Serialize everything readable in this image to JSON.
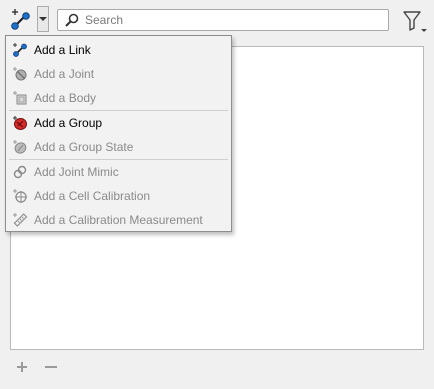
{
  "toolbar": {
    "add_button_icon": "link-add-icon",
    "dropdown_icon": "chevron-down-icon",
    "filter_icon": "filter-icon"
  },
  "search": {
    "placeholder": "Search",
    "value": ""
  },
  "menu": {
    "items": [
      {
        "label": "Add a Link",
        "icon": "link-icon",
        "enabled": true
      },
      {
        "label": "Add a Joint",
        "icon": "joint-icon",
        "enabled": false
      },
      {
        "label": "Add a Body",
        "icon": "body-icon",
        "enabled": false
      },
      {
        "label": "Add a Group",
        "icon": "group-icon",
        "enabled": true
      },
      {
        "label": "Add a Group State",
        "icon": "group-state-icon",
        "enabled": false
      },
      {
        "label": "Add Joint Mimic",
        "icon": "joint-mimic-icon",
        "enabled": false
      },
      {
        "label": "Add a Cell Calibration",
        "icon": "cell-calibration-icon",
        "enabled": false
      },
      {
        "label": "Add a Calibration Measurement",
        "icon": "calibration-measurement-icon",
        "enabled": false
      }
    ]
  },
  "bottom": {
    "add_icon": "plus-icon",
    "remove_icon": "minus-icon"
  },
  "colors": {
    "background": "#f0f0f0",
    "list_background": "#ffffff",
    "menu_background": "#f2f2f2",
    "disabled_text": "#8a8a8a",
    "link_blue": "#1e6fc7",
    "group_red": "#d42a2a"
  }
}
